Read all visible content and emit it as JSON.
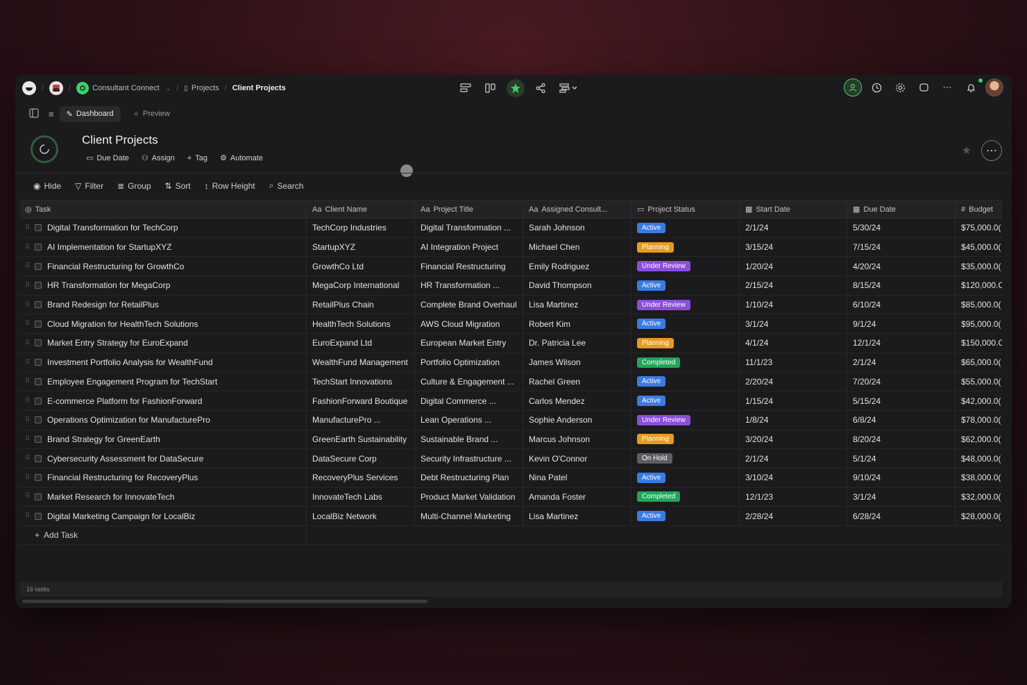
{
  "breadcrumb": {
    "workspace": "Consultant Connect",
    "projects": "Projects",
    "current": "Client Projects"
  },
  "subnav": {
    "dashboard": "Dashboard",
    "preview": "Preview"
  },
  "project": {
    "title": "Client Projects",
    "actions": [
      "Due Date",
      "Assign",
      "Tag",
      "Automate"
    ]
  },
  "toolbar": {
    "hide": "Hide",
    "filter": "Filter",
    "group": "Group",
    "sort": "Sort",
    "row_height": "Row Height",
    "search": "Search"
  },
  "columns": {
    "task": "Task",
    "client": "Client Name",
    "title": "Project Title",
    "consultant": "Assigned Consult...",
    "status": "Project Status",
    "start": "Start Date",
    "due": "Due Date",
    "budget": "Budget"
  },
  "status_colors": {
    "Active": "#3b7be0",
    "Planning": "#e89a1c",
    "Under Review": "#8a4fd8",
    "Completed": "#22a55a",
    "On Hold": "#5e5e62"
  },
  "rows": [
    {
      "task": "Digital Transformation for TechCorp",
      "client": "TechCorp Industries",
      "title": "Digital Transformation ...",
      "consultant": "Sarah Johnson",
      "status": "Active",
      "start": "2/1/24",
      "due": "5/30/24",
      "budget": "$75,000.0("
    },
    {
      "task": "AI Implementation for StartupXYZ",
      "client": "StartupXYZ",
      "title": "AI Integration Project",
      "consultant": "Michael Chen",
      "status": "Planning",
      "start": "3/15/24",
      "due": "7/15/24",
      "budget": "$45,000.0("
    },
    {
      "task": "Financial Restructuring for GrowthCo",
      "client": "GrowthCo Ltd",
      "title": "Financial Restructuring",
      "consultant": "Emily Rodriguez",
      "status": "Under Review",
      "start": "1/20/24",
      "due": "4/20/24",
      "budget": "$35,000.0("
    },
    {
      "task": "HR Transformation for MegaCorp",
      "client": "MegaCorp International",
      "title": "HR Transformation ...",
      "consultant": "David Thompson",
      "status": "Active",
      "start": "2/15/24",
      "due": "8/15/24",
      "budget": "$120,000.C"
    },
    {
      "task": "Brand Redesign for RetailPlus",
      "client": "RetailPlus Chain",
      "title": "Complete Brand Overhaul",
      "consultant": "Lisa Martinez",
      "status": "Under Review",
      "start": "1/10/24",
      "due": "6/10/24",
      "budget": "$85,000.0("
    },
    {
      "task": "Cloud Migration for HealthTech Solutions",
      "client": "HealthTech Solutions",
      "title": "AWS Cloud Migration",
      "consultant": "Robert Kim",
      "status": "Active",
      "start": "3/1/24",
      "due": "9/1/24",
      "budget": "$95,000.0("
    },
    {
      "task": "Market Entry Strategy for EuroExpand",
      "client": "EuroExpand Ltd",
      "title": "European Market Entry",
      "consultant": "Dr. Patricia Lee",
      "status": "Planning",
      "start": "4/1/24",
      "due": "12/1/24",
      "budget": "$150,000.C"
    },
    {
      "task": "Investment Portfolio Analysis for WealthFund",
      "client": "WealthFund Management",
      "title": "Portfolio Optimization",
      "consultant": "James Wilson",
      "status": "Completed",
      "start": "11/1/23",
      "due": "2/1/24",
      "budget": "$65,000.0("
    },
    {
      "task": "Employee Engagement Program for TechStart",
      "client": "TechStart Innovations",
      "title": "Culture & Engagement ...",
      "consultant": "Rachel Green",
      "status": "Active",
      "start": "2/20/24",
      "due": "7/20/24",
      "budget": "$55,000.0("
    },
    {
      "task": "E-commerce Platform for FashionForward",
      "client": "FashionForward Boutique",
      "title": "Digital Commerce ...",
      "consultant": "Carlos Mendez",
      "status": "Active",
      "start": "1/15/24",
      "due": "5/15/24",
      "budget": "$42,000.0("
    },
    {
      "task": "Operations Optimization for ManufacturePro",
      "client": "ManufacturePro ...",
      "title": "Lean Operations ...",
      "consultant": "Sophie Anderson",
      "status": "Under Review",
      "start": "1/8/24",
      "due": "6/8/24",
      "budget": "$78,000.0("
    },
    {
      "task": "Brand Strategy for GreenEarth",
      "client": "GreenEarth Sustainability",
      "title": "Sustainable Brand ...",
      "consultant": "Marcus Johnson",
      "status": "Planning",
      "start": "3/20/24",
      "due": "8/20/24",
      "budget": "$62,000.0("
    },
    {
      "task": "Cybersecurity Assessment for DataSecure",
      "client": "DataSecure Corp",
      "title": "Security Infrastructure ...",
      "consultant": "Kevin O'Connor",
      "status": "On Hold",
      "start": "2/1/24",
      "due": "5/1/24",
      "budget": "$48,000.0("
    },
    {
      "task": "Financial Restructuring for RecoveryPlus",
      "client": "RecoveryPlus Services",
      "title": "Debt Restructuring Plan",
      "consultant": "Nina Patel",
      "status": "Active",
      "start": "3/10/24",
      "due": "9/10/24",
      "budget": "$38,000.0("
    },
    {
      "task": "Market Research for InnovateTech",
      "client": "InnovateTech Labs",
      "title": "Product Market Validation",
      "consultant": "Amanda Foster",
      "status": "Completed",
      "start": "12/1/23",
      "due": "3/1/24",
      "budget": "$32,000.0("
    },
    {
      "task": "Digital Marketing Campaign for LocalBiz",
      "client": "LocalBiz Network",
      "title": "Multi-Channel Marketing",
      "consultant": "Lisa Martinez",
      "status": "Active",
      "start": "2/28/24",
      "due": "6/28/24",
      "budget": "$28,000.0("
    }
  ],
  "add_task": "Add Task",
  "footer": {
    "count": "16 tasks"
  }
}
